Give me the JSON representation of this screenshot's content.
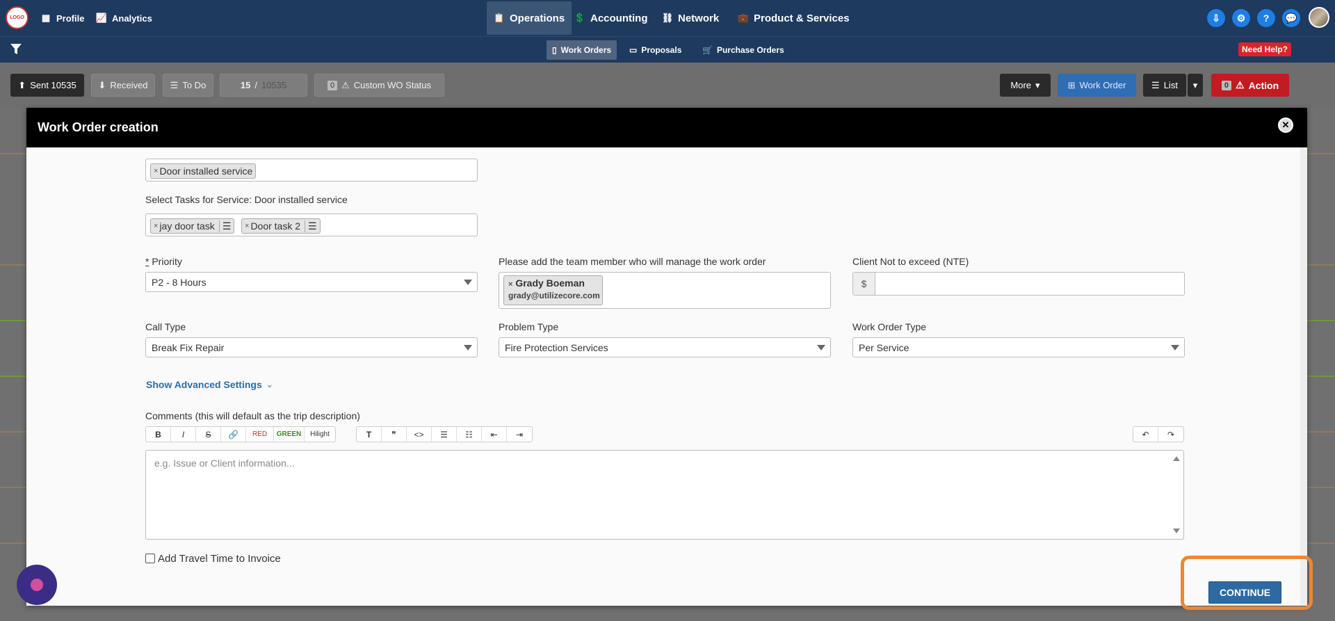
{
  "topnav": {
    "logo_text": "LOGO",
    "profile": "Profile",
    "analytics": "Analytics",
    "operations": "Operations",
    "accounting": "Accounting",
    "network": "Network",
    "products": "Product & Services",
    "help_icon_label": "?"
  },
  "subnav": {
    "work_orders": "Work Orders",
    "proposals": "Proposals",
    "purchase_orders": "Purchase Orders",
    "need_help": "Need Help?"
  },
  "toolbar": {
    "sent": "Sent 10535",
    "received": "Received",
    "todo": "To Do",
    "page_current": "15",
    "page_sep": " / ",
    "page_total": "10535",
    "custom_count": "0",
    "custom_status": "Custom WO Status",
    "more": "More",
    "work_order": "Work Order",
    "list": "List",
    "action_count": "0",
    "action": "Action"
  },
  "modal": {
    "title": "Work Order creation",
    "service_tag": "Door installed service",
    "tasks_label": "Select Tasks for Service: Door installed service",
    "task_tags": [
      "jay door task",
      "Door task 2"
    ],
    "priority_star": "*",
    "priority_label": " Priority",
    "priority_value": "P2 - 8 Hours",
    "team_label": "Please add the team member who will manage the work order",
    "team_member_name": "Grady Boeman",
    "team_member_email": "grady@utilizecore.com",
    "nte_label": "Client Not to exceed (NTE)",
    "nte_prefix": "$",
    "call_type_label": "Call Type",
    "call_type_value": "Break Fix Repair",
    "problem_type_label": "Problem Type",
    "problem_type_value": "Fire Protection Services",
    "wo_type_label": "Work Order Type",
    "wo_type_value": "Per Service",
    "advanced": "Show Advanced Settings",
    "comments_label": "Comments (this will default as the trip description)",
    "editor": {
      "bold": "B",
      "italic": "I",
      "strike": "S",
      "link": "🔗",
      "red": "RED",
      "green": "GREEN",
      "hilight": "Hilight",
      "heading": "T",
      "quote": "❞",
      "code": "<>",
      "ul": "☰",
      "ol": "☷",
      "outdent": "⇤",
      "indent": "⇥",
      "undo": "↶",
      "redo": "↷"
    },
    "comments_placeholder": "e.g. Issue or Client information...",
    "travel_time": "Add Travel Time to Invoice",
    "continue": "CONTINUE"
  },
  "colors": {
    "nav_bg": "#1e3a5f",
    "accent_blue": "#2d6aa3",
    "action_red": "#c01c22",
    "highlight_orange": "#e8883a"
  }
}
